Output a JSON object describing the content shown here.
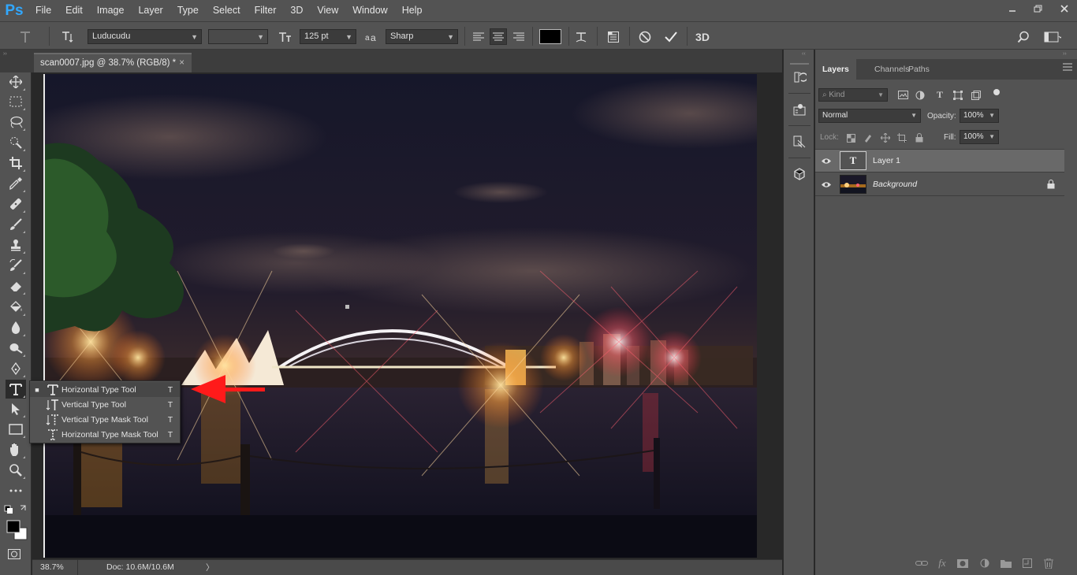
{
  "app": {
    "logo": "Ps"
  },
  "menu": [
    "File",
    "Edit",
    "Image",
    "Layer",
    "Type",
    "Select",
    "Filter",
    "3D",
    "View",
    "Window",
    "Help"
  ],
  "window_controls": [
    "minimize-icon",
    "restore-icon",
    "close-icon"
  ],
  "options": {
    "font_family": "Luducudu",
    "font_style": "",
    "font_size": "125 pt",
    "antialias": "Sharp",
    "alignment_selected": "center",
    "text_color": "#000000",
    "threed_label": "3D"
  },
  "document": {
    "tab_title": "scan0007.jpg @ 38.7% (RGB/8) *",
    "close_glyph": "×",
    "zoom": "38.7%",
    "doc_size": "Doc: 10.6M/10.6M",
    "status_arrow": "〉"
  },
  "tools": [
    "move",
    "marquee",
    "lasso",
    "quick-select",
    "crop",
    "eyedropper",
    "healing",
    "brush",
    "stamp",
    "history-brush",
    "eraser",
    "paint-bucket",
    "blur",
    "dodge",
    "pen",
    "type",
    "path-select",
    "rectangle",
    "hand",
    "zoom",
    "more"
  ],
  "active_tool": "type",
  "flyout": {
    "items": [
      {
        "label": "Horizontal Type Tool",
        "shortcut": "T",
        "icon": "horizontal-type-icon",
        "selected": true
      },
      {
        "label": "Vertical Type Tool",
        "shortcut": "T",
        "icon": "vertical-type-icon",
        "selected": false
      },
      {
        "label": "Vertical Type Mask Tool",
        "shortcut": "T",
        "icon": "vertical-type-mask-icon",
        "selected": false
      },
      {
        "label": "Horizontal Type Mask Tool",
        "shortcut": "T",
        "icon": "horizontal-type-mask-icon",
        "selected": false
      }
    ],
    "bullet": "■"
  },
  "annotation": {
    "arrow_color": "#ff1a1a"
  },
  "panel": {
    "tabs": [
      "Layers",
      "Channels",
      "Paths"
    ],
    "active_tab": "Layers",
    "filter_placeholder": "Kind",
    "blend_mode": "Normal",
    "opacity_label": "Opacity:",
    "opacity": "100%",
    "lock_label": "Lock:",
    "fill_label": "Fill:",
    "fill": "100%",
    "layers": [
      {
        "name": "Layer 1",
        "type": "text",
        "thumb_glyph": "T",
        "visible": true,
        "selected": true,
        "locked": false
      },
      {
        "name": "Background",
        "type": "image",
        "visible": true,
        "selected": false,
        "locked": true
      }
    ]
  }
}
